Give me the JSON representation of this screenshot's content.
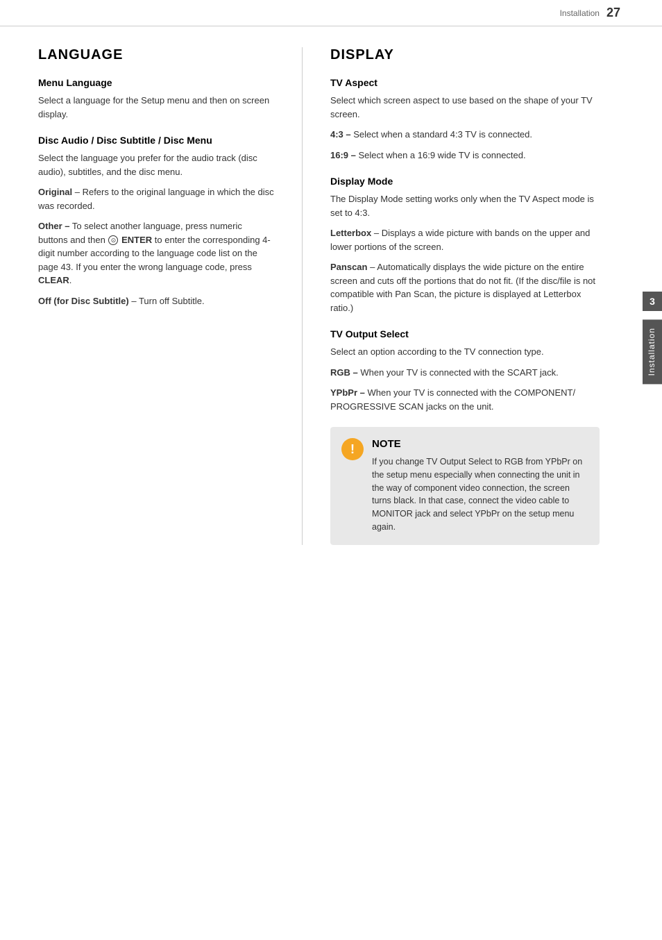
{
  "header": {
    "section": "Installation",
    "page_number": "27"
  },
  "side_tab": {
    "number": "3",
    "label": "Installation"
  },
  "left_section": {
    "title": "LANGUAGE",
    "subsections": [
      {
        "id": "menu-language",
        "title": "Menu Language",
        "body": "Select a language for the Setup menu and then on screen display."
      },
      {
        "id": "disc-audio",
        "title": "Disc Audio / Disc Subtitle / Disc Menu",
        "body": "Select the language you prefer for the audio track (disc audio), subtitles, and the disc menu."
      },
      {
        "id": "original",
        "term": "Original",
        "term_suffix": " – Refers to the original language in which the disc was recorded."
      },
      {
        "id": "other",
        "term": "Other –",
        "body_before": " To select another language, press numeric buttons and then ",
        "enter_symbol": "⊙",
        "enter_label": "ENTER",
        "body_after": " to enter the corresponding 4-digit number according to the language code list on the page 43. If you enter the wrong language code, press ",
        "clear_label": "CLEAR",
        "period": "."
      },
      {
        "id": "off-disc-subtitle",
        "term": "Off (for Disc Subtitle)",
        "body": " – Turn off Subtitle."
      }
    ]
  },
  "right_section": {
    "title": "DISPLAY",
    "subsections": [
      {
        "id": "tv-aspect",
        "title": "TV Aspect",
        "intro": "Select which screen aspect to use based on the shape of your TV screen.",
        "items": [
          {
            "term": "4:3 –",
            "body": " Select when a standard 4:3 TV is connected."
          },
          {
            "term": "16:9 –",
            "body": " Select when a 16:9 wide TV is connected."
          }
        ]
      },
      {
        "id": "display-mode",
        "title": "Display Mode",
        "intro": "The Display Mode setting works only when the TV Aspect mode is set to 4:3.",
        "items": [
          {
            "term": "Letterbox",
            "body": " – Displays a wide picture with bands on the upper and lower portions of the screen."
          },
          {
            "term": "Panscan",
            "body": " – Automatically displays the wide picture on the entire screen and cuts off the portions that do not fit. (If the disc/file is not compatible with Pan Scan, the picture is displayed at Letterbox ratio.)"
          }
        ]
      },
      {
        "id": "tv-output",
        "title": "TV Output Select",
        "intro": "Select an option according to the TV connection type.",
        "items": [
          {
            "term": "RGB –",
            "body": " When your TV is connected with the SCART jack."
          },
          {
            "term": "YPbPr –",
            "body": " When your TV is connected with the COMPONENT/ PROGRESSIVE SCAN jacks on the unit."
          }
        ]
      }
    ],
    "note": {
      "title": "NOTE",
      "body": "If you change TV Output Select to RGB from YPbPr on the setup menu especially when connecting the unit in the way of component video connection, the screen turns black. In that case, connect the video cable to MONITOR jack and select YPbPr on the setup menu again."
    }
  }
}
